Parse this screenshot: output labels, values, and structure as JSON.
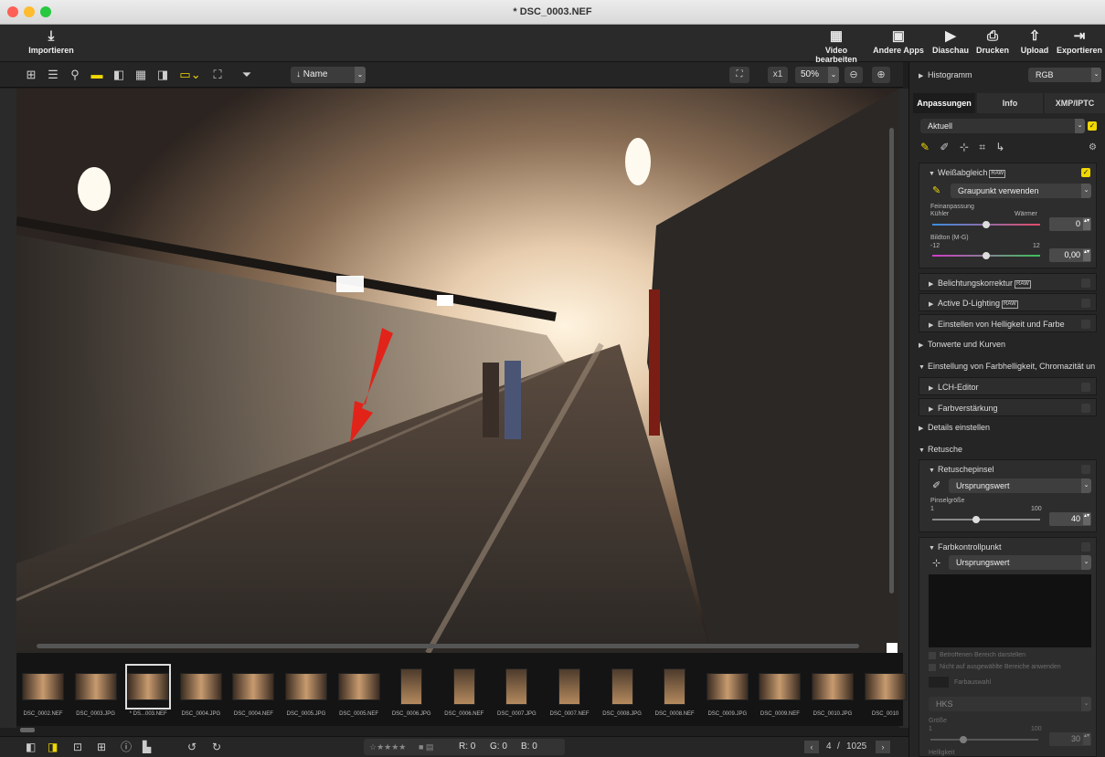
{
  "window": {
    "title": "* DSC_0003.NEF"
  },
  "toolbar": {
    "import": "Importieren",
    "video": "Video bearbeiten",
    "apps": "Andere Apps",
    "slideshow": "Diaschau",
    "print": "Drucken",
    "upload": "Upload",
    "export": "Exportieren"
  },
  "viewbar": {
    "sort_label": "Name",
    "zoom_x1": "x1",
    "zoom_value": "50%"
  },
  "histogram": {
    "label": "Histogramm",
    "channel": "RGB"
  },
  "tabs": [
    "Anpassungen",
    "Info",
    "XMP/IPTC"
  ],
  "preset": "Aktuell",
  "white_balance": {
    "title": "Weißabgleich",
    "raw": "RAW",
    "mode": "Graupunkt verwenden",
    "fine_label": "Feinanpassung",
    "cooler": "Kühler",
    "warmer": "Wärmer",
    "fine_value": "0",
    "tint_label": "Bildton (M-G)",
    "tint_min": "-12",
    "tint_max": "12",
    "tint_value": "0,00"
  },
  "sections": {
    "exposure": "Belichtungskorrektur",
    "adl": "Active D-Lighting",
    "brightness": "Einstellen von Helligkeit und Farbe",
    "curves": "Tonwerte und Kurven",
    "lch_group": "Einstellung von Farbhelligkeit, Chromazität un",
    "lch": "LCH-Editor",
    "color_boost": "Farbverstärkung",
    "details": "Details einstellen",
    "retouch": "Retusche"
  },
  "retouch_brush": {
    "title": "Retuschepinsel",
    "mode": "Ursprungswert",
    "size_label": "Pinselgröße",
    "min": "1",
    "max": "100",
    "value": "40"
  },
  "color_control": {
    "title": "Farbkontrollpunkt",
    "mode": "Ursprungswert",
    "opt1": "Betroffenen Bereich darstellen",
    "opt2": "Nicht auf ausgewählte Bereiche anwenden",
    "color_select": "Farbauswahl",
    "hks": "HKS",
    "size_label": "Größe",
    "size_min": "1",
    "size_max": "100",
    "size_value": "30",
    "brightness_label": "Helligkeit"
  },
  "filmstrip": [
    {
      "name": "DSC_0002.NEF",
      "v": false
    },
    {
      "name": "DSC_0003.JPG",
      "v": false
    },
    {
      "name": "* DS...003.NEF",
      "v": false
    },
    {
      "name": "DSC_0004.JPG",
      "v": false
    },
    {
      "name": "DSC_0004.NEF",
      "v": false
    },
    {
      "name": "DSC_0005.JPG",
      "v": false
    },
    {
      "name": "DSC_0005.NEF",
      "v": false
    },
    {
      "name": "DSC_0006.JPG",
      "v": true
    },
    {
      "name": "DSC_0006.NEF",
      "v": true
    },
    {
      "name": "DSC_0007.JPG",
      "v": true
    },
    {
      "name": "DSC_0007.NEF",
      "v": true
    },
    {
      "name": "DSC_0008.JPG",
      "v": true
    },
    {
      "name": "DSC_0008.NEF",
      "v": true
    },
    {
      "name": "DSC_0009.JPG",
      "v": false
    },
    {
      "name": "DSC_0009.NEF",
      "v": false
    },
    {
      "name": "DSC_0010.JPG",
      "v": false
    },
    {
      "name": "DSC_0010",
      "v": false
    }
  ],
  "bottombar": {
    "stars": "☆★★★★",
    "r": "R: 0",
    "g": "G: 0",
    "b": "B: 0",
    "page": "4",
    "sep": "/",
    "total": "1025"
  }
}
